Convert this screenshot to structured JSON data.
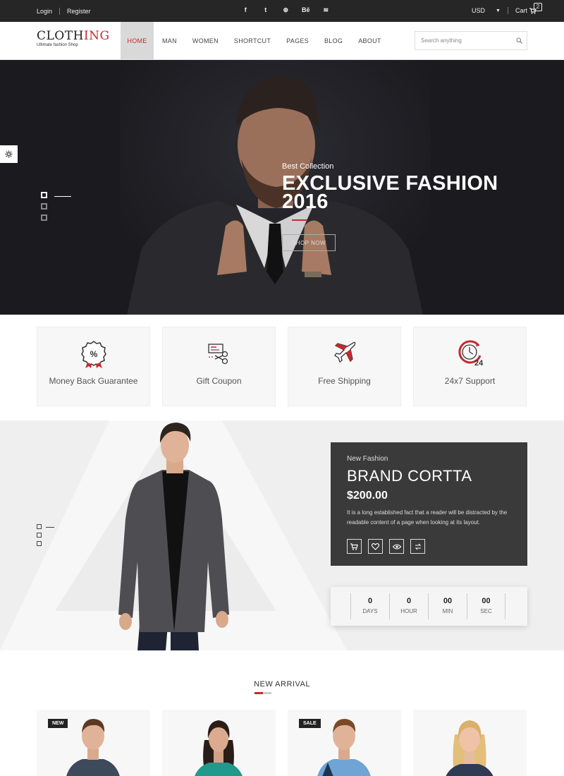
{
  "topbar": {
    "login": "Login",
    "register": "Register",
    "social_icons": [
      "facebook-icon",
      "twitter-icon",
      "dribbble-icon",
      "behance-icon",
      "rss-icon"
    ],
    "social_glyphs": [
      "f",
      "t",
      "⊕",
      "Bē",
      "≋"
    ],
    "currency": "USD",
    "cart_label": "Cart",
    "cart_count": "2"
  },
  "header": {
    "logo_text": "CLOTHING",
    "logo_part1": "CLOTH",
    "logo_part2": "ING",
    "tagline": "Ultimate fashion Shop",
    "nav": [
      "HOME",
      "MAN",
      "WOMEN",
      "SHORTCUT",
      "PAGES",
      "BLOG",
      "ABOUT"
    ],
    "active_nav": "HOME",
    "search_placeholder": "Search anything"
  },
  "hero": {
    "subtitle": "Best Collection",
    "title": "EXCLUSIVE FASHION 2016",
    "button": "SHOP NOW",
    "slides": 3,
    "active_slide": 1
  },
  "features": [
    {
      "label": "Money Back Guarantee",
      "icon": "percent-badge-icon"
    },
    {
      "label": "Gift Coupon",
      "icon": "coupon-scissors-icon"
    },
    {
      "label": "Free Shipping",
      "icon": "airplane-icon"
    },
    {
      "label": "24x7 Support",
      "icon": "clock-24-icon"
    }
  ],
  "promo": {
    "kicker": "New Fashion",
    "brand": "BRAND CORTTA",
    "price": "$200.00",
    "description": "It is a long established fact that a reader will be distracted by the readable content of a page when looking at its layout.",
    "actions": [
      "cart-icon",
      "heart-icon",
      "eye-icon",
      "compare-icon"
    ],
    "countdown": [
      {
        "value": "0",
        "unit": "DAYS"
      },
      {
        "value": "0",
        "unit": "HOUR"
      },
      {
        "value": "00",
        "unit": "MIN"
      },
      {
        "value": "00",
        "unit": "SEC"
      }
    ]
  },
  "new_arrival": {
    "title": "NEW ARRIVAL",
    "products": [
      {
        "tag": "NEW"
      },
      {
        "tag": ""
      },
      {
        "tag": "SALE"
      },
      {
        "tag": ""
      }
    ]
  },
  "colors": {
    "accent": "#c8282e",
    "topbar": "#262626",
    "card": "#3a3a3a"
  }
}
